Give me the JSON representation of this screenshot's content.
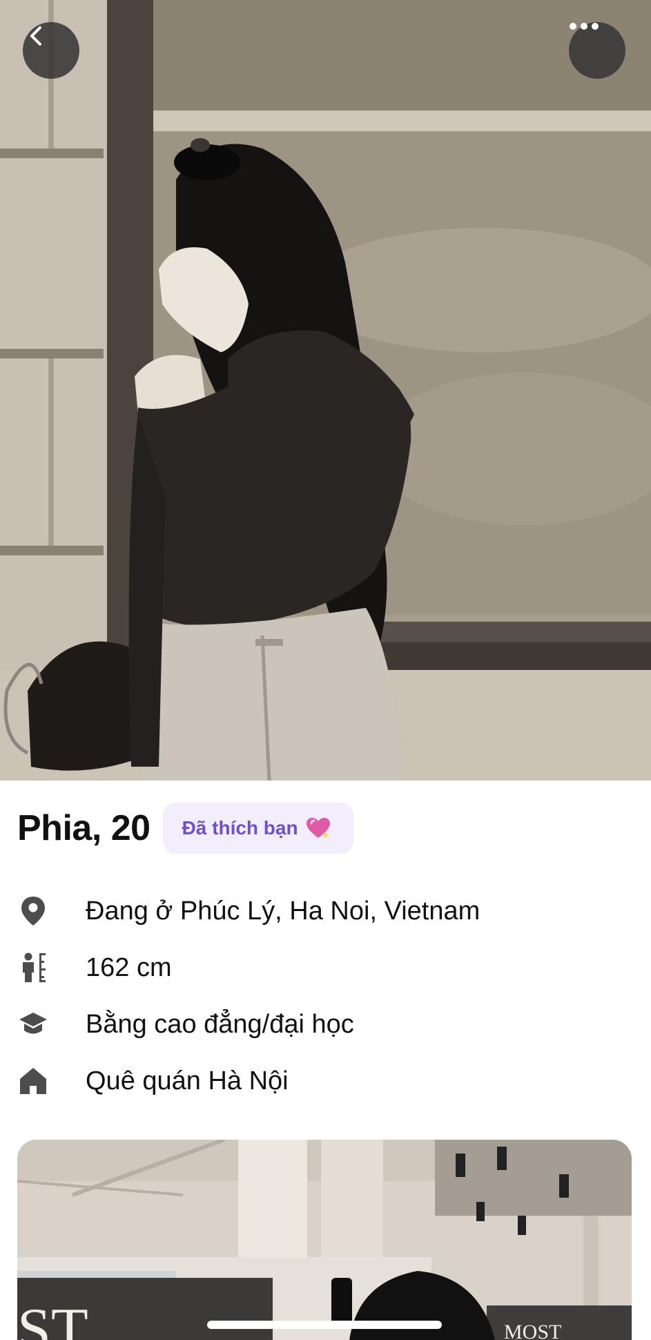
{
  "header": {
    "back_icon": "chevron-left-icon",
    "more_icon": "more-horizontal-icon"
  },
  "profile": {
    "name_age": "Phia, 20",
    "liked_badge": {
      "label": "Đã thích bạn",
      "icon": "heart-sparkle-icon",
      "color": "#6e4fd0",
      "background": "#f3eefe"
    },
    "details": [
      {
        "icon": "location-pin-icon",
        "text": "Đang ở Phúc Lý, Ha Noi, Vietnam"
      },
      {
        "icon": "height-icon",
        "text": "162 cm"
      },
      {
        "icon": "graduation-cap-icon",
        "text": "Bằng cao đẳng/đại học"
      },
      {
        "icon": "home-icon",
        "text": "Quê quán Hà Nội"
      }
    ]
  },
  "second_photo": {
    "sign_text_left": "ST",
    "sign_text_right": "MOST"
  }
}
